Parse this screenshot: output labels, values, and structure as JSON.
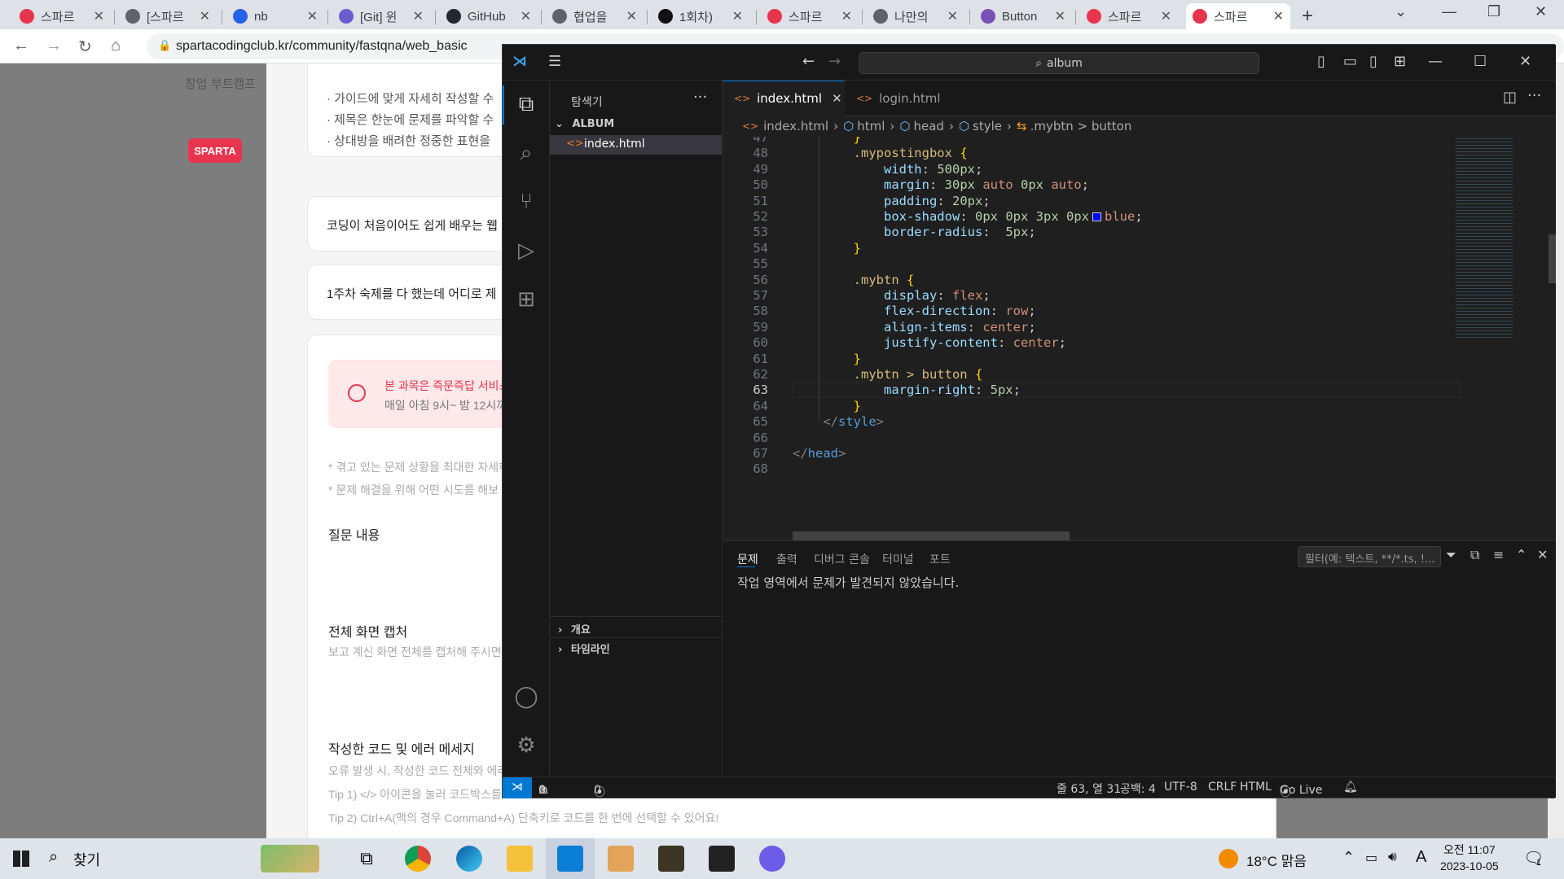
{
  "browser": {
    "tabs": [
      {
        "title": "스파르",
        "icon": "sparta-heart-icon",
        "color": "#e8344e"
      },
      {
        "title": "[스파르",
        "icon": "globe-icon",
        "color": "#5f6368"
      },
      {
        "title": "nb",
        "icon": "bookmark-app-icon",
        "color": "#2563eb"
      },
      {
        "title": "[Git] 윈",
        "icon": "flask-icon",
        "color": "#6d5bd0"
      },
      {
        "title": "GitHub",
        "icon": "github-icon",
        "color": "#24292f"
      },
      {
        "title": "협업을",
        "icon": "globe-icon",
        "color": "#5f6368"
      },
      {
        "title": "1회차)",
        "icon": "notion-icon",
        "color": "#111111"
      },
      {
        "title": "스파르",
        "icon": "sparta-heart-icon",
        "color": "#e8344e"
      },
      {
        "title": "나만의",
        "icon": "globe-icon",
        "color": "#5f6368"
      },
      {
        "title": "Button",
        "icon": "bootstrap-icon",
        "color": "#7952b3"
      },
      {
        "title": "스파르",
        "icon": "sparta-heart-icon",
        "color": "#e8344e"
      },
      {
        "title": "스파르",
        "icon": "sparta-heart-icon",
        "color": "#e8344e"
      }
    ],
    "active_tab": 11,
    "url": "spartacodingclub.kr/community/fastqna/web_basic"
  },
  "webpage": {
    "nav_item": "창업 부트캠프",
    "logo_text": "SPARTA",
    "guide_lines": [
      "· 가이드에 맞게 자세히 작성할 수",
      "· 제목은 한눈에 문제를 파악할 수",
      "· 상대방을 배려한 정중한 표현을"
    ],
    "course_item_1": "코딩이 처음이어도 쉽게 배우는 웹",
    "course_item_2": "1주차 숙제를 다 했는데 어디로 제",
    "notice_title": "본 과목은 즉문즉답 서비스",
    "notice_sub": "매일 아침 9시~ 밤 12시까",
    "hint_1": "* 겪고 있는 문제 상황을 최대한 자세히",
    "hint_2": "* 문제 해결을 위해 어떤 시도를 해보",
    "question_heading": "질문 내용",
    "capture_heading": "전체 화면 캡처",
    "capture_sub": "보고 계신 화면 전체를 캡처해 주시면",
    "code_heading": "작성한 코드 및 에러 메세지",
    "code_sub": "오류 발생 시, 작성한 코드 전체와 에러",
    "tip_1": "Tip 1) </> 아이콘을 눌러 코드박스를",
    "tip_2": "Tip 2) Ctrl+A(맥의 경우 Command+A) 단축키로 코드를 한 번에 선택할 수 있어요!"
  },
  "vscode": {
    "search_text": "album",
    "explorer_title": "탐색기",
    "folder": "ALBUM",
    "files": [
      "index.html"
    ],
    "outline": "개요",
    "timeline": "타임라인",
    "editor_tabs": [
      {
        "label": "index.html",
        "active": true
      },
      {
        "label": "login.html",
        "active": false
      }
    ],
    "breadcrumbs": [
      "index.html",
      "html",
      "head",
      "style",
      ".mybtn > button"
    ],
    "code_lines": [
      {
        "n": "47",
        "t": "        }"
      },
      {
        "n": "48",
        "t": "        .mypostingbox {"
      },
      {
        "n": "49",
        "t": "            width: 500px;"
      },
      {
        "n": "50",
        "t": "            margin: 30px auto 0px auto;"
      },
      {
        "n": "51",
        "t": "            padding: 20px;"
      },
      {
        "n": "52",
        "t": "            box-shadow: 0px 0px 3px 0px   blue;"
      },
      {
        "n": "53",
        "t": "            border-radius:  5px;"
      },
      {
        "n": "54",
        "t": "        }"
      },
      {
        "n": "55",
        "t": ""
      },
      {
        "n": "56",
        "t": "        .mybtn {"
      },
      {
        "n": "57",
        "t": "            display: flex;"
      },
      {
        "n": "58",
        "t": "            flex-direction: row;"
      },
      {
        "n": "59",
        "t": "            align-items: center;"
      },
      {
        "n": "60",
        "t": "            justify-content: center;"
      },
      {
        "n": "61",
        "t": "        }"
      },
      {
        "n": "62",
        "t": "        .mybtn > button {"
      },
      {
        "n": "63",
        "t": "            margin-right: 5px;"
      },
      {
        "n": "64",
        "t": "        }"
      },
      {
        "n": "65",
        "t": "    </style>"
      },
      {
        "n": "66",
        "t": ""
      },
      {
        "n": "67",
        "t": "</head>"
      },
      {
        "n": "68",
        "t": ""
      }
    ],
    "current_line": "63",
    "panel_tabs": [
      "문제",
      "출력",
      "디버그 콘솔",
      "터미널",
      "포트"
    ],
    "active_panel_tab": 0,
    "filter_placeholder": "필터(예: 텍스트, **/*.ts, !...",
    "problems_message": "작업 영역에서 문제가 발견되지 않았습니다.",
    "status": {
      "errors": "0",
      "warnings": "0",
      "ports": "0",
      "position": "줄 63, 열 31",
      "spaces": "공백: 4",
      "encoding": "UTF-8",
      "eol": "CRLF",
      "language": "HTML",
      "golive": "Go Live"
    }
  },
  "taskbar": {
    "search_label": "찾기",
    "weather": "18°C  맑음",
    "ime": "A",
    "time": "오전 11:07",
    "date": "2023-10-05",
    "notifications": "1"
  }
}
